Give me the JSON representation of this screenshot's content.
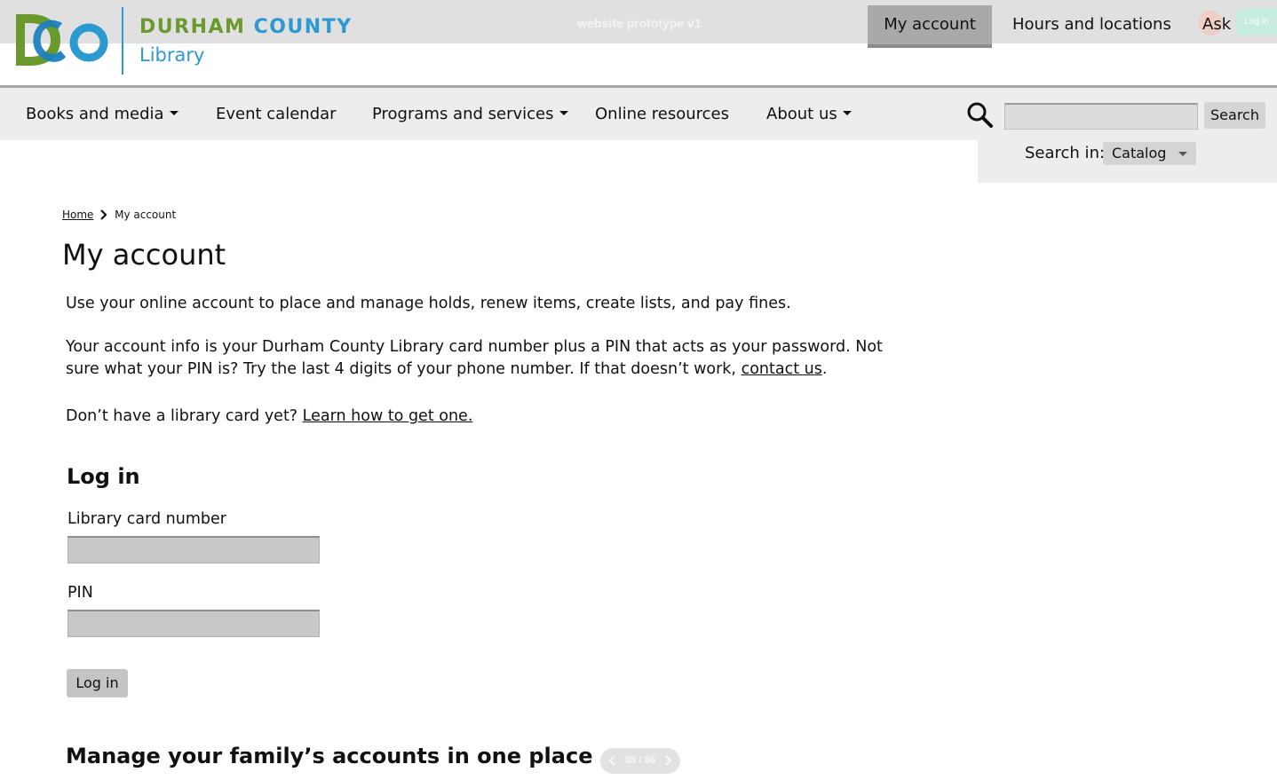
{
  "prototype_label": "website prototype v1",
  "brand": {
    "name_part1": "DURHAM",
    "name_part2": "COUNTY",
    "sub": "Library",
    "colors": {
      "green": "#6a9a2e",
      "blue": "#2b9ad0"
    }
  },
  "utility_nav": {
    "my_account": "My account",
    "hours": "Hours and locations",
    "ask": "Ask us",
    "login_chip": "Log in"
  },
  "main_nav": {
    "items": [
      {
        "label": "Books and media",
        "dropdown": true
      },
      {
        "label": "Event calendar",
        "dropdown": false
      },
      {
        "label": "Programs and services",
        "dropdown": true
      },
      {
        "label": "Online resources",
        "dropdown": false
      },
      {
        "label": "About us",
        "dropdown": true
      }
    ]
  },
  "search": {
    "button_label": "Search",
    "input_value": "",
    "search_in_label": "Search in:",
    "scope_selected": "Catalog"
  },
  "breadcrumb": {
    "home": "Home",
    "current": "My account"
  },
  "page": {
    "title": "My account",
    "intro": "Use your online account to place and manage holds, renew items, create lists, and pay fines.",
    "info_text": "Your account info is your Durham County Library card number plus a PIN that acts as your password. Not sure what your PIN is? Try the last 4 digits of your phone number. If that doesn’t work,",
    "contact_link": "contact us",
    "info_end": ".",
    "card_question": "Don’t have a library card yet?",
    "card_link": "Learn how to get one."
  },
  "login_form": {
    "title": "Log in",
    "card_label": "Library card number",
    "card_value": "",
    "pin_label": "PIN",
    "pin_value": "",
    "submit_label": "Log in"
  },
  "family": {
    "title": "Manage your family’s accounts in one place"
  },
  "pager": {
    "text": "35 / 36"
  }
}
